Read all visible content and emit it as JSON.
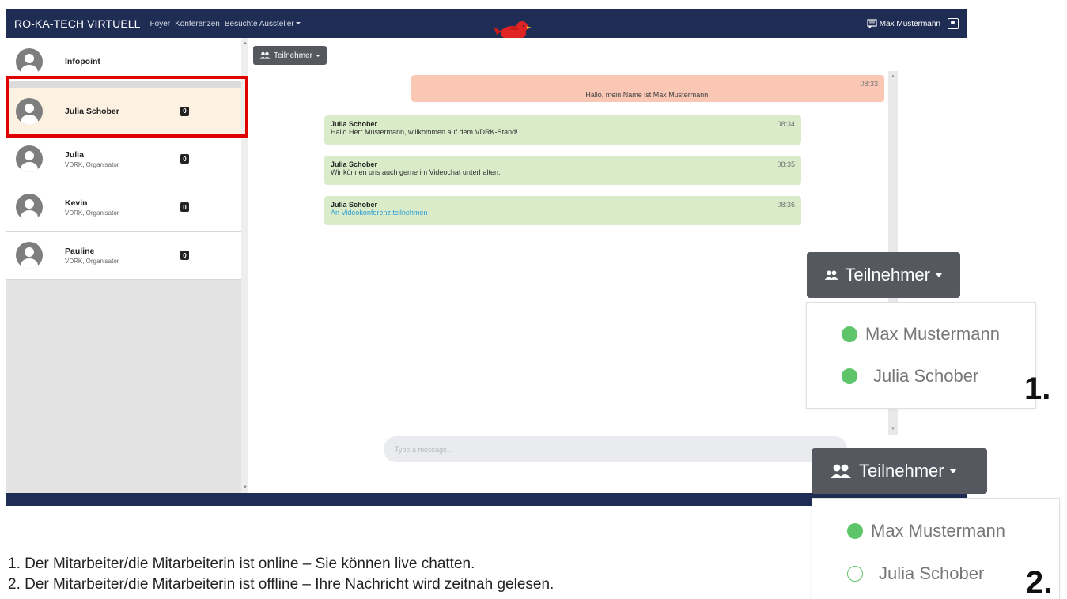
{
  "navbar": {
    "brand": "RO-KA-TECH VIRTUELL",
    "links": [
      "Foyer",
      "Konferenzen",
      "Besuchte Aussteller"
    ],
    "user_name": "Max Mustermann"
  },
  "sidebar": {
    "contacts": [
      {
        "name": "Infopoint",
        "role": "",
        "badge": ""
      },
      {
        "name": "Julia Schober",
        "role": "",
        "badge": "0"
      },
      {
        "name": "Julia",
        "role": "VDRK, Organisator",
        "badge": "0"
      },
      {
        "name": "Kevin",
        "role": "VDRK, Organisator",
        "badge": "0"
      },
      {
        "name": "Pauline",
        "role": "VDRK, Organisator",
        "badge": "0"
      }
    ]
  },
  "chat": {
    "participants_button": "Teilnehmer",
    "messages": [
      {
        "author": "",
        "text": "Hallo, mein Name ist Max Mustermann.",
        "time": "08:33"
      },
      {
        "author": "Julia Schober",
        "text": "Hallo Herr Mustermann, willkommen auf dem VDRK-Stand!",
        "time": "08:34"
      },
      {
        "author": "Julia Schober",
        "text": "Wir können uns auch gerne im Videochat unterhalten.",
        "time": "08:35"
      },
      {
        "author": "Julia Schober",
        "text": "An Videokonferenz teilnehmen",
        "time": "08:36"
      }
    ],
    "input_placeholder": "Type a message..."
  },
  "callouts": [
    {
      "number": "1.",
      "button": "Teilnehmer",
      "participants": [
        {
          "name": "Max Mustermann",
          "status": "online"
        },
        {
          "name": "Julia Schober",
          "status": "online"
        }
      ]
    },
    {
      "number": "2.",
      "button": "Teilnehmer",
      "participants": [
        {
          "name": "Max Mustermann",
          "status": "online"
        },
        {
          "name": "Julia Schober",
          "status": "offline"
        }
      ]
    }
  ],
  "captions": [
    "1. Der Mitarbeiter/die Mitarbeiterin ist online – Sie können live chatten.",
    "2. Der Mitarbeiter/die Mitarbeiterin ist offline – Ihre Nachricht wird zeitnah gelesen."
  ],
  "colors": {
    "navbar": "#1f2d55",
    "highlight": "#e10000",
    "online": "#5fc56b",
    "own_message": "#f9c7b4",
    "other_message": "#d9ebc8"
  }
}
